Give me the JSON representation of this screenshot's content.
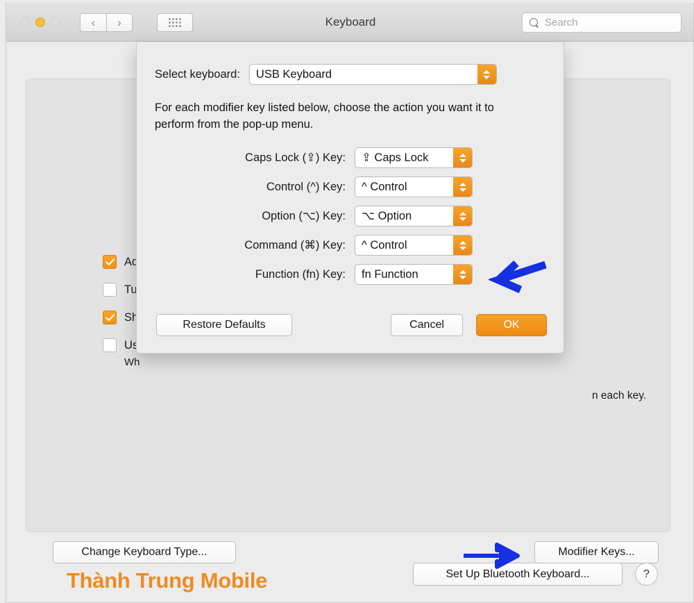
{
  "window": {
    "title": "Keyboard",
    "traffic_lights": [
      "close",
      "minimize",
      "zoom"
    ],
    "nav_back": "‹",
    "nav_forward": "›",
    "grid_button": "show-all",
    "search": {
      "placeholder": "Search",
      "value": ""
    }
  },
  "background_panel": {
    "checkboxes": [
      {
        "label": "Adj",
        "checked": true
      },
      {
        "label": "Tur",
        "checked": false
      },
      {
        "label": "Sho",
        "checked": true
      },
      {
        "label": "Use",
        "checked": false
      }
    ],
    "sub_text": "Wh",
    "tail_text": "n each key.",
    "buttons": {
      "change_keyboard_type": "Change Keyboard Type...",
      "modifier_keys": "Modifier Keys...",
      "set_up_bluetooth_keyboard": "Set Up Bluetooth Keyboard...",
      "help": "?"
    },
    "watermark": "Thành Trung Mobile"
  },
  "dialog": {
    "select_keyboard_label": "Select keyboard:",
    "select_keyboard_value": "USB Keyboard",
    "instruction": "For each modifier key listed below, choose the action you want it to perform from the pop-up menu.",
    "rows": [
      {
        "label": "Caps Lock (⇪) Key:",
        "value": "⇪ Caps Lock"
      },
      {
        "label": "Control (^) Key:",
        "value": "^ Control"
      },
      {
        "label": "Option (⌥) Key:",
        "value": "⌥ Option"
      },
      {
        "label": "Command (⌘) Key:",
        "value": "^ Control"
      },
      {
        "label": "Function (fn) Key:",
        "value": "fn Function"
      }
    ],
    "buttons": {
      "restore_defaults": "Restore Defaults",
      "cancel": "Cancel",
      "ok": "OK"
    }
  },
  "annotations": {
    "arrow_command_row": "blue-arrow-left",
    "arrow_modifier_button": "blue-arrow-right"
  },
  "colors": {
    "accent_orange": "#ef8a12",
    "annotation_blue": "#1430e0",
    "watermark_orange": "#ef8b22"
  }
}
